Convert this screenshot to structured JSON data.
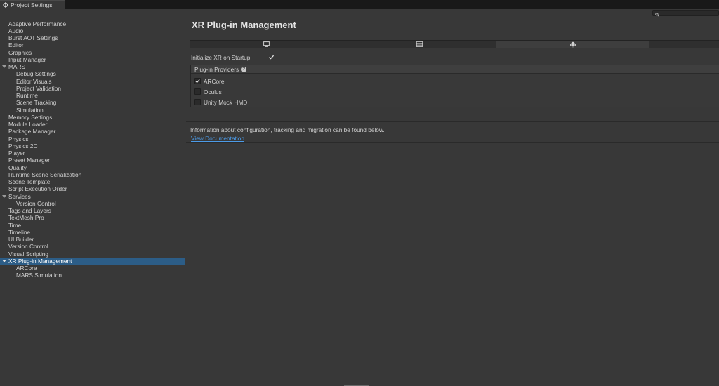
{
  "window": {
    "tab_title": "Project Settings",
    "tab_icon": "gear-icon"
  },
  "search": {
    "placeholder": "",
    "icon": "search-icon"
  },
  "sidebar": {
    "items": [
      {
        "label": "Adaptive Performance",
        "level": 0,
        "expandable": false
      },
      {
        "label": "Audio",
        "level": 0,
        "expandable": false
      },
      {
        "label": "Burst AOT Settings",
        "level": 0,
        "expandable": false
      },
      {
        "label": "Editor",
        "level": 0,
        "expandable": false
      },
      {
        "label": "Graphics",
        "level": 0,
        "expandable": false
      },
      {
        "label": "Input Manager",
        "level": 0,
        "expandable": false
      },
      {
        "label": "MARS",
        "level": 0,
        "expandable": true
      },
      {
        "label": "Debug Settings",
        "level": 1,
        "expandable": false
      },
      {
        "label": "Editor Visuals",
        "level": 1,
        "expandable": false
      },
      {
        "label": "Project Validation",
        "level": 1,
        "expandable": false
      },
      {
        "label": "Runtime",
        "level": 1,
        "expandable": false
      },
      {
        "label": "Scene Tracking",
        "level": 1,
        "expandable": false
      },
      {
        "label": "Simulation",
        "level": 1,
        "expandable": false
      },
      {
        "label": "Memory Settings",
        "level": 0,
        "expandable": false
      },
      {
        "label": "Module Loader",
        "level": 0,
        "expandable": false
      },
      {
        "label": "Package Manager",
        "level": 0,
        "expandable": false
      },
      {
        "label": "Physics",
        "level": 0,
        "expandable": false
      },
      {
        "label": "Physics 2D",
        "level": 0,
        "expandable": false
      },
      {
        "label": "Player",
        "level": 0,
        "expandable": false
      },
      {
        "label": "Preset Manager",
        "level": 0,
        "expandable": false
      },
      {
        "label": "Quality",
        "level": 0,
        "expandable": false
      },
      {
        "label": "Runtime Scene Serialization",
        "level": 0,
        "expandable": false
      },
      {
        "label": "Scene Template",
        "level": 0,
        "expandable": false
      },
      {
        "label": "Script Execution Order",
        "level": 0,
        "expandable": false
      },
      {
        "label": "Services",
        "level": 0,
        "expandable": true
      },
      {
        "label": "Version Control",
        "level": 1,
        "expandable": false
      },
      {
        "label": "Tags and Layers",
        "level": 0,
        "expandable": false
      },
      {
        "label": "TextMesh Pro",
        "level": 0,
        "expandable": false
      },
      {
        "label": "Time",
        "level": 0,
        "expandable": false
      },
      {
        "label": "Timeline",
        "level": 0,
        "expandable": false
      },
      {
        "label": "UI Builder",
        "level": 0,
        "expandable": false
      },
      {
        "label": "Version Control",
        "level": 0,
        "expandable": false
      },
      {
        "label": "Visual Scripting",
        "level": 0,
        "expandable": false
      },
      {
        "label": "XR Plug-in Management",
        "level": 0,
        "expandable": true,
        "selected": true
      },
      {
        "label": "ARCore",
        "level": 1,
        "expandable": false
      },
      {
        "label": "MARS Simulation",
        "level": 1,
        "expandable": false
      }
    ]
  },
  "main": {
    "title": "XR Plug-in Management",
    "platform_tabs": [
      {
        "icon": "desktop-icon",
        "active": false
      },
      {
        "icon": "list-icon",
        "active": false
      },
      {
        "icon": "android-icon",
        "active": true
      }
    ],
    "init_on_startup": {
      "label": "Initialize XR on Startup",
      "checked": true
    },
    "providers": {
      "header": "Plug-in Providers",
      "help_icon": "help-icon",
      "help_glyph": "?",
      "items": [
        {
          "label": "ARCore",
          "checked": true
        },
        {
          "label": "Oculus",
          "checked": false
        },
        {
          "label": "Unity Mock HMD",
          "checked": false
        }
      ]
    },
    "info_text": "Information about configuration, tracking and migration can be found below.",
    "doc_link": "View Documentation"
  },
  "colors": {
    "background": "#383838",
    "selection": "#2c5d87",
    "link": "#4c9be8",
    "titlebar": "#191919"
  }
}
